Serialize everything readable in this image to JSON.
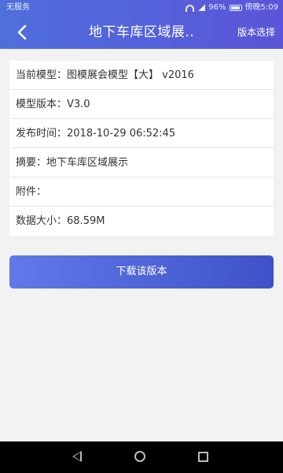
{
  "status_bar": {
    "carrier": "无服务",
    "battery": "96%",
    "clock": "傍晚5:09"
  },
  "header": {
    "title": "地下车库区域展..",
    "action_label": "版本选择"
  },
  "details": [
    {
      "label": "当前模型：",
      "value": "图模展会模型【大】 v2016"
    },
    {
      "label": "模型版本：",
      "value": "V3.0"
    },
    {
      "label": "发布时间：",
      "value": "2018-10-29 06:52:45"
    },
    {
      "label": "摘要：",
      "value": "地下车库区域展示"
    },
    {
      "label": "附件：",
      "value": ""
    },
    {
      "label": "数据大小：",
      "value": "68.59M"
    }
  ],
  "download_label": "下载该版本",
  "battery_level": 0.96,
  "colors": {
    "header_start": "#4f6fdc",
    "header_end": "#5a55d8",
    "button_start": "#6179e8",
    "button_end": "#3f52c9"
  },
  "icons": [
    "wifi-icon",
    "signal-icon",
    "battery-icon",
    "back-arrow-icon",
    "nav-back-icon",
    "nav-home-icon",
    "nav-recents-icon"
  ]
}
